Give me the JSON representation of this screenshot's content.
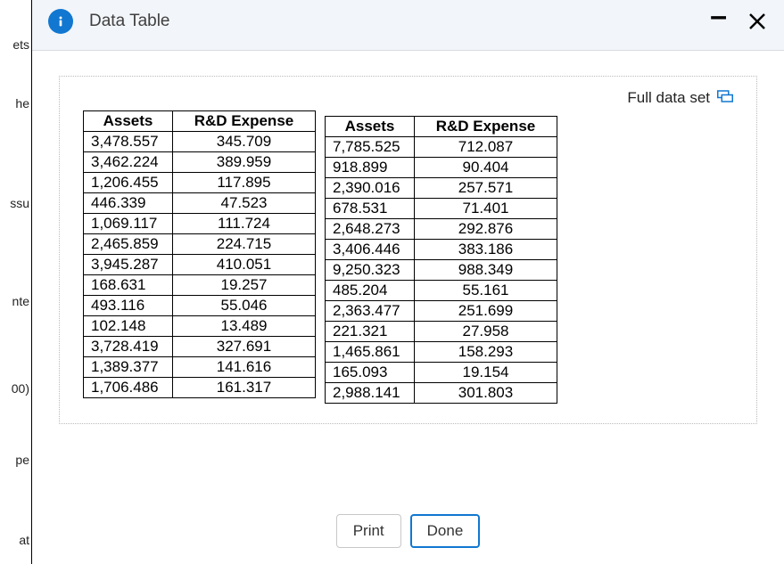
{
  "dialog": {
    "title": "Data Table",
    "full_data_set_label": "Full data set",
    "buttons": {
      "print": "Print",
      "done": "Done"
    }
  },
  "table": {
    "headers": {
      "assets": "Assets",
      "rd_expense": "R&D Expense"
    },
    "left_rows": [
      {
        "assets": "3,478.557",
        "rd": "345.709"
      },
      {
        "assets": "3,462.224",
        "rd": "389.959"
      },
      {
        "assets": "1,206.455",
        "rd": "117.895"
      },
      {
        "assets": "446.339",
        "rd": "47.523"
      },
      {
        "assets": "1,069.117",
        "rd": "111.724"
      },
      {
        "assets": "2,465.859",
        "rd": "224.715"
      },
      {
        "assets": "3,945.287",
        "rd": "410.051"
      },
      {
        "assets": "168.631",
        "rd": "19.257"
      },
      {
        "assets": "493.116",
        "rd": "55.046"
      },
      {
        "assets": "102.148",
        "rd": "13.489"
      },
      {
        "assets": "3,728.419",
        "rd": "327.691"
      },
      {
        "assets": "1,389.377",
        "rd": "141.616"
      },
      {
        "assets": "1,706.486",
        "rd": "161.317"
      }
    ],
    "right_rows": [
      {
        "assets": "7,785.525",
        "rd": "712.087"
      },
      {
        "assets": "918.899",
        "rd": "90.404"
      },
      {
        "assets": "2,390.016",
        "rd": "257.571"
      },
      {
        "assets": "678.531",
        "rd": "71.401"
      },
      {
        "assets": "2,648.273",
        "rd": "292.876"
      },
      {
        "assets": "3,406.446",
        "rd": "383.186"
      },
      {
        "assets": "9,250.323",
        "rd": "988.349"
      },
      {
        "assets": "485.204",
        "rd": "55.161"
      },
      {
        "assets": "2,363.477",
        "rd": "251.699"
      },
      {
        "assets": "221.321",
        "rd": "27.958"
      },
      {
        "assets": "1,465.861",
        "rd": "158.293"
      },
      {
        "assets": "165.093",
        "rd": "19.154"
      },
      {
        "assets": "2,988.141",
        "rd": "301.803"
      }
    ]
  },
  "bg_fragments": {
    "f1": "ets",
    "f2": "he",
    "f3": "ssu",
    "f4": "nte",
    "f5": "00)",
    "f6": "pe",
    "f7": "at"
  }
}
